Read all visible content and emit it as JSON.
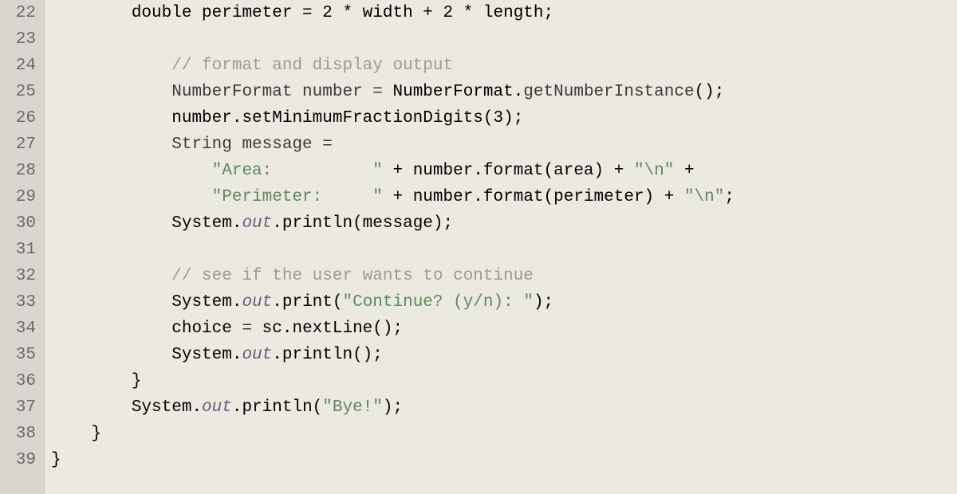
{
  "gutter": {
    "start": 22,
    "end": 39
  },
  "code": {
    "l22": "        double perimeter = 2 * width + 2 * length;",
    "l23": "",
    "l24_comment": "// format and display output",
    "l25_a": "NumberFormat number ",
    "l25_b": "=",
    "l25_c": " NumberFormat.",
    "l25_d": "getNumberInstance",
    "l25_e": "();",
    "l26_a": "number.setMinimumFractionDigits(",
    "l26_b": "3",
    "l26_c": ");",
    "l27_a": "String message ",
    "l27_b": "=",
    "l28_a": "\"Area:          \"",
    "l28_b": " + number.format(area) + ",
    "l28_c": "\"\\n\"",
    "l28_d": " +",
    "l29_a": "\"Perimeter:     \"",
    "l29_b": " + number.format(perimeter) + ",
    "l29_c": "\"\\n\"",
    "l29_d": ";",
    "l30_a": "System.",
    "l30_b": "out",
    "l30_c": ".println(message);",
    "l31": "",
    "l32_comment": "// see if the user wants to continue",
    "l33_a": "System.",
    "l33_b": "out",
    "l33_c": ".print(",
    "l33_d": "\"Continue? (y/n): \"",
    "l33_e": ");",
    "l34_a": "choice ",
    "l34_b": "=",
    "l34_c": " sc.nextLine();",
    "l35_a": "System.",
    "l35_b": "out",
    "l35_c": ".println();",
    "l36": "}",
    "l37_a": "System.",
    "l37_b": "out",
    "l37_c": ".println(",
    "l37_d": "\"Bye!\"",
    "l37_e": ");",
    "l38": "}",
    "l39": "}"
  },
  "indent": {
    "i0": "",
    "i1": "    ",
    "i2": "        ",
    "i3": "            ",
    "i4": "                ",
    "i5": "                    "
  }
}
